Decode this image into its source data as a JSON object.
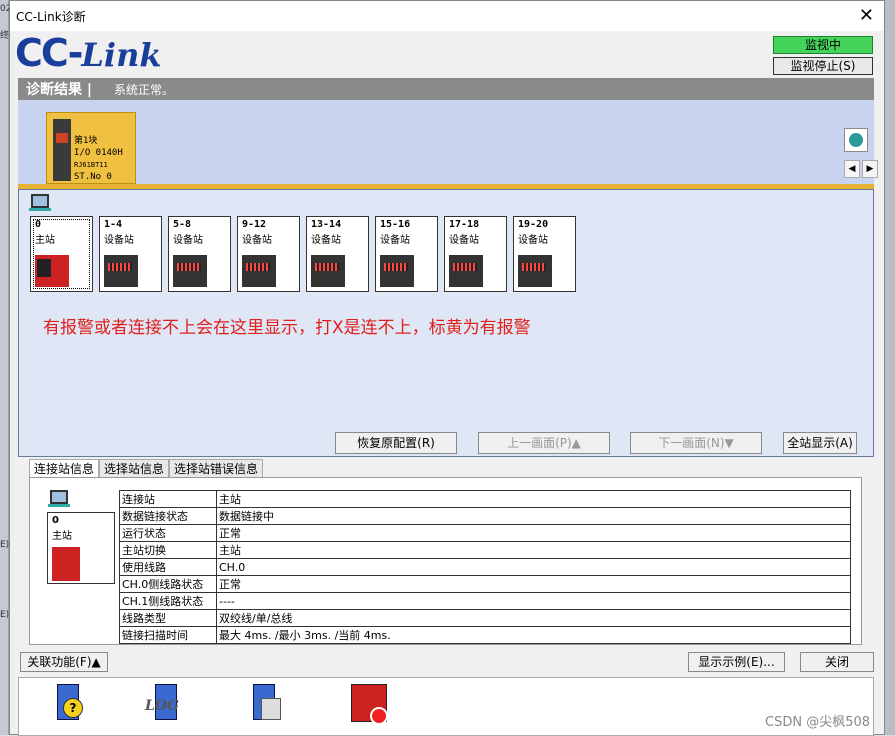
{
  "window": {
    "title": "CC-Link诊断",
    "close_glyph": "✕"
  },
  "logo": {
    "cc": "CC-",
    "link": "Link"
  },
  "monitor": {
    "status": "监视中",
    "stop_label": "监视停止(S)",
    "status_color": "#45d45a"
  },
  "result": {
    "label": "诊断结果 |",
    "status": "系统正常。"
  },
  "cpu": {
    "line1": "第1块",
    "line2": "I/O 0140H",
    "line3": "RJ61BT11",
    "line4": "ST.No 0"
  },
  "stations": [
    {
      "num": "0",
      "type": "主站"
    },
    {
      "num": "1-4",
      "type": "设备站"
    },
    {
      "num": "5-8",
      "type": "设备站"
    },
    {
      "num": "9-12",
      "type": "设备站"
    },
    {
      "num": "13-14",
      "type": "设备站"
    },
    {
      "num": "15-16",
      "type": "设备站"
    },
    {
      "num": "17-18",
      "type": "设备站"
    },
    {
      "num": "19-20",
      "type": "设备站"
    }
  ],
  "annotation": "有报警或者连接不上会在这里显示，打X是连不上，标黄为有报警",
  "panel_buttons": {
    "restore": "恢复原配置(R)",
    "prev": "上一画面(P)▲",
    "next": "下一画面(N)▼",
    "all": "全站显示(A)"
  },
  "tabs": [
    "连接站信息",
    "选择站信息",
    "选择站错误信息"
  ],
  "info_station": {
    "num": "0",
    "type": "主站"
  },
  "info_rows": [
    {
      "key": "连接站",
      "value": "主站"
    },
    {
      "key": "数据链接状态",
      "value": "数据链接中"
    },
    {
      "key": "运行状态",
      "value": "正常"
    },
    {
      "key": "主站切换",
      "value": "主站"
    },
    {
      "key": "使用线路",
      "value": "CH.0"
    },
    {
      "key": "CH.0侧线路状态",
      "value": "正常"
    },
    {
      "key": "CH.1侧线路状态",
      "value": "----"
    },
    {
      "key": "线路类型",
      "value": "双绞线/单/总线"
    },
    {
      "key": "链接扫描时间",
      "value": "最大 4ms. /最小 3ms. /当前 4ms."
    }
  ],
  "bottom_buttons": {
    "related": "关联功能(F)▲",
    "legend": "显示示例(E)...",
    "close": "关闭"
  },
  "tools": [
    {
      "label": "?"
    },
    {
      "label": "LOG"
    },
    {
      "label": ""
    },
    {
      "label": ""
    }
  ],
  "watermark": "CSDN @尖枫508"
}
